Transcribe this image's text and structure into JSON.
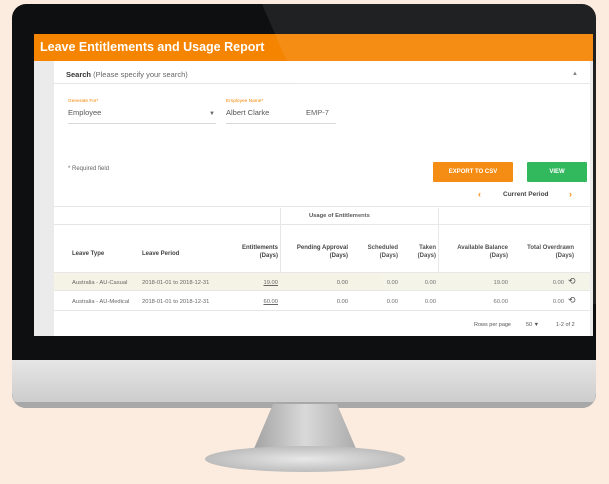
{
  "app": {
    "title": "Leave Entitlements and Usage Report"
  },
  "search": {
    "heading": "Search",
    "hint": "(Please specify your search)",
    "generate_for": {
      "label": "Generate For*",
      "value": "Employee"
    },
    "employee_name": {
      "label": "Employee Name*",
      "value": "Albert Clarke",
      "id": "EMP-7"
    },
    "required_note": "* Required field",
    "export_label": "EXPORT TO CSV",
    "view_label": "VIEW"
  },
  "report": {
    "period_label": "Current Period",
    "group_header": "Usage of Entitlements",
    "columns": {
      "leave_type": "Leave Type",
      "leave_period": "Leave Period",
      "entitlements": {
        "name": "Entitlements",
        "unit": "(Days)"
      },
      "pending": {
        "name": "Pending Approval",
        "unit": "(Days)"
      },
      "scheduled": {
        "name": "Scheduled",
        "unit": "(Days)"
      },
      "taken": {
        "name": "Taken",
        "unit": "(Days)"
      },
      "available": {
        "name": "Available Balance",
        "unit": "(Days)"
      },
      "overdrawn": {
        "name": "Total Overdrawn",
        "unit": "(Days)"
      }
    },
    "rows": [
      {
        "leave_type": "Australia - AU-Casual",
        "leave_period": "2018-01-01 to 2018-12-31",
        "entitlements": "19.00",
        "pending": "0.00",
        "scheduled": "0.00",
        "taken": "0.00",
        "available": "19.00",
        "overdrawn": "0.00"
      },
      {
        "leave_type": "Australia - AU-Medical",
        "leave_period": "2018-01-01 to 2018-12-31",
        "entitlements": "60.00",
        "pending": "0.00",
        "scheduled": "0.00",
        "taken": "0.00",
        "available": "60.00",
        "overdrawn": "0.00"
      }
    ],
    "pagination": {
      "rows_per_page_label": "Rows per page",
      "rows_per_page": "50",
      "range": "1-2 of 2"
    }
  },
  "colors": {
    "accent": "#f58400",
    "view_button": "#22b450",
    "row_highlight": "#f5f3e6"
  },
  "icons": {
    "collapse": "chevron-up-icon",
    "prev": "chevron-left-icon",
    "next": "chevron-right-icon",
    "history": "history-icon",
    "dropdown": "caret-down-icon"
  }
}
